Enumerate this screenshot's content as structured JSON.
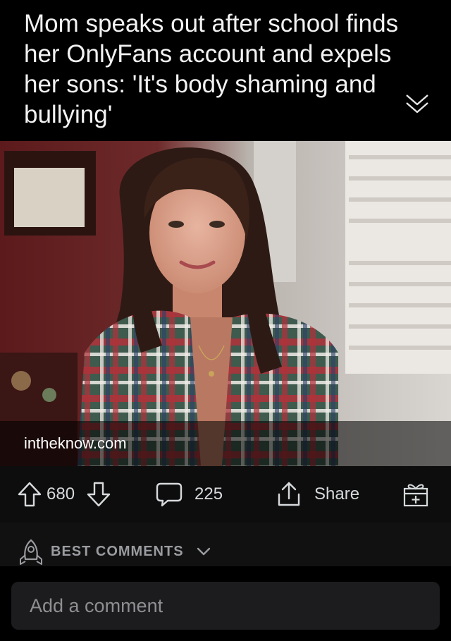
{
  "post": {
    "title": "Mom speaks out after school finds her OnlyFans account and expels her sons: 'It's body shaming and bullying'",
    "link_domain": "intheknow.com"
  },
  "actions": {
    "vote_count": "680",
    "comment_count": "225",
    "share_label": "Share"
  },
  "comments": {
    "sort_label": "BEST COMMENTS",
    "input_placeholder": "Add a comment"
  },
  "icons": {
    "collapse": "double-chevron-down-icon",
    "upvote": "upvote-arrow-icon",
    "downvote": "downvote-arrow-icon",
    "comment": "speech-bubble-icon",
    "share": "share-upload-icon",
    "award": "gift-box-icon",
    "sort": "rocket-icon",
    "sort_dropdown": "chevron-down-icon"
  },
  "colors": {
    "background": "#000000",
    "title_text": "#f2f2f2",
    "action_text": "#d7dadc",
    "muted_text": "#9a9ca0",
    "input_bg": "#1c1c1e"
  }
}
